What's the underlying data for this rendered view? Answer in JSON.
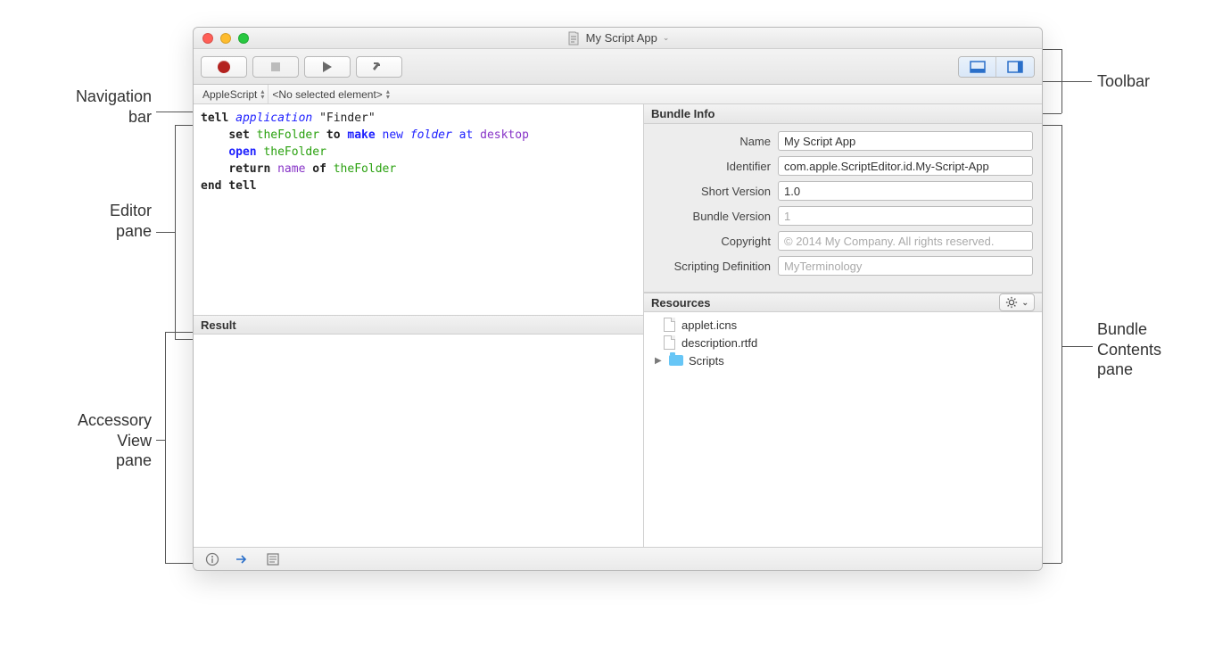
{
  "callouts": {
    "navigation_bar": "Navigation\nbar",
    "editor_pane": "Editor\npane",
    "accessory_view_pane": "Accessory\nView\npane",
    "toolbar": "Toolbar",
    "bundle_contents_pane": "Bundle\nContents\npane"
  },
  "titlebar": {
    "title": "My Script App"
  },
  "navbar": {
    "language": "AppleScript",
    "element": "<No selected element>"
  },
  "editor": {
    "tell": "tell",
    "application": "application",
    "finder_str": "\"Finder\"",
    "set": "set",
    "theFolder": "theFolder",
    "to": "to",
    "make": "make",
    "new": "new",
    "folder": "folder",
    "at": "at",
    "desktop": "desktop",
    "open": "open",
    "return": "return",
    "name": "name",
    "of": "of",
    "end_tell": "end tell"
  },
  "result": {
    "header": "Result"
  },
  "bundle_info": {
    "header": "Bundle Info",
    "fields": {
      "name_label": "Name",
      "name_value": "My Script App",
      "identifier_label": "Identifier",
      "identifier_value": "com.apple.ScriptEditor.id.My-Script-App",
      "short_version_label": "Short Version",
      "short_version_value": "1.0",
      "bundle_version_label": "Bundle Version",
      "bundle_version_placeholder": "1",
      "copyright_label": "Copyright",
      "copyright_placeholder": "© 2014 My Company. All rights reserved.",
      "scripting_def_label": "Scripting Definition",
      "scripting_def_placeholder": "MyTerminology"
    }
  },
  "resources": {
    "header": "Resources",
    "items": {
      "applet": "applet.icns",
      "description": "description.rtfd",
      "scripts": "Scripts"
    }
  }
}
